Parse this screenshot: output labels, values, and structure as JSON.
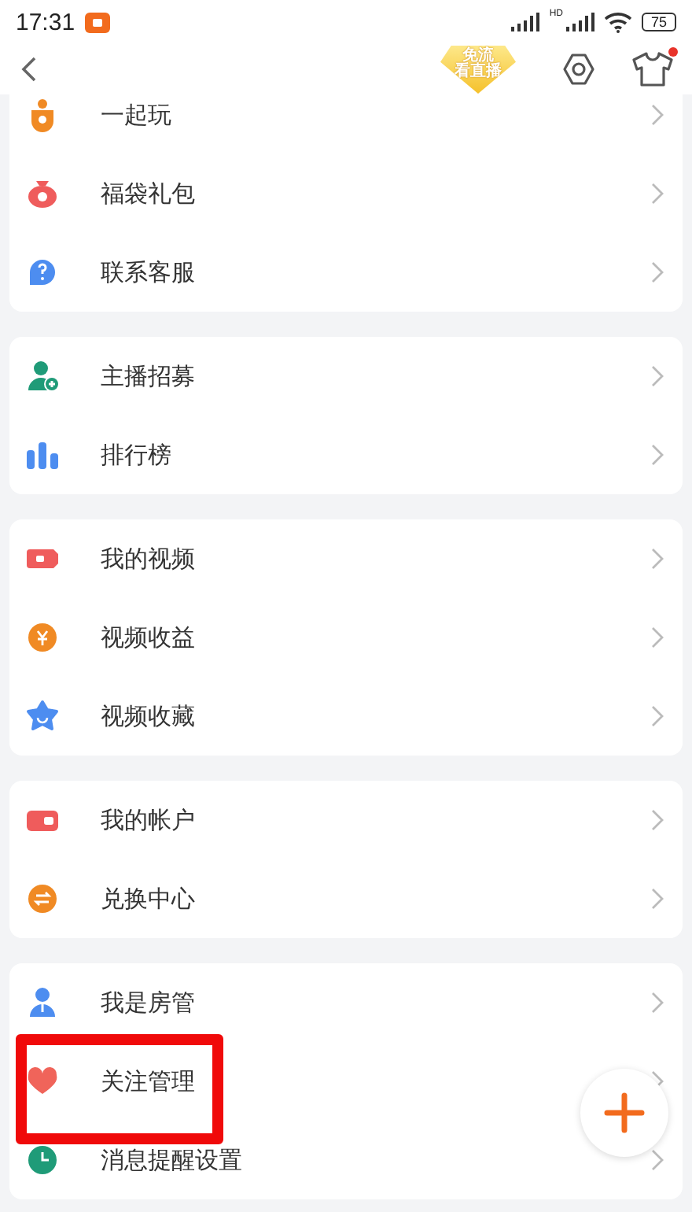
{
  "status_bar": {
    "time": "17:31",
    "network_label": "HD",
    "battery": "75"
  },
  "header": {
    "badge_lines": [
      "免流",
      "看直播"
    ],
    "notification_dot": true
  },
  "groups": [
    {
      "items": [
        {
          "label": "一起玩"
        },
        {
          "label": "福袋礼包"
        },
        {
          "label": "联系客服"
        }
      ]
    },
    {
      "items": [
        {
          "label": "主播招募"
        },
        {
          "label": "排行榜"
        }
      ]
    },
    {
      "items": [
        {
          "label": "我的视频"
        },
        {
          "label": "视频收益"
        },
        {
          "label": "视频收藏"
        }
      ]
    },
    {
      "items": [
        {
          "label": "我的帐户"
        },
        {
          "label": "兑换中心"
        }
      ]
    },
    {
      "items": [
        {
          "label": "我是房管"
        },
        {
          "label": "关注管理"
        },
        {
          "label": "消息提醒设置"
        }
      ]
    }
  ],
  "highlight": {
    "visible": true
  }
}
